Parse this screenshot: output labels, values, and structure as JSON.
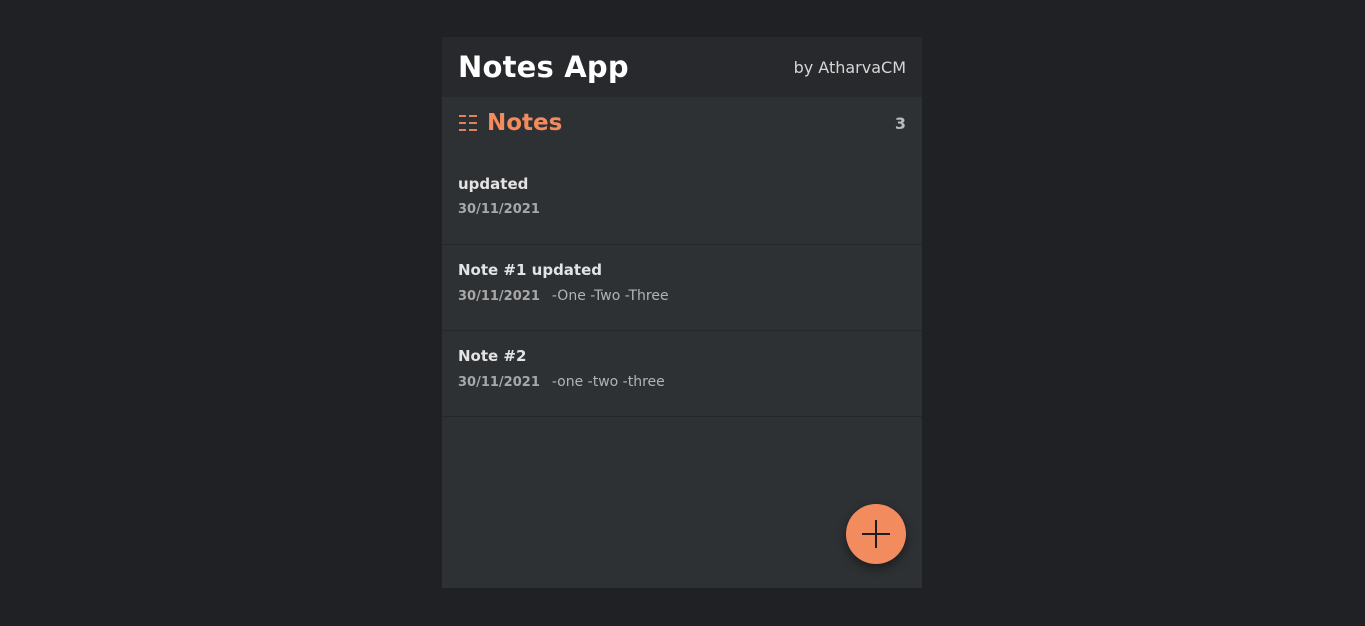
{
  "header": {
    "title": "Notes App",
    "author": "by AtharvaCM"
  },
  "notes_section": {
    "icon": "list-icon",
    "heading": "Notes",
    "count": "3"
  },
  "notes": [
    {
      "title": "updated",
      "date": "30/11/2021",
      "preview": ""
    },
    {
      "title": "Note #1 updated",
      "date": "30/11/2021",
      "preview": "-One -Two -Three"
    },
    {
      "title": "Note #2",
      "date": "30/11/2021",
      "preview": "-one -two -three"
    }
  ],
  "fab": {
    "icon": "plus-icon"
  },
  "colors": {
    "background": "#202124",
    "panel": "#2e3134",
    "header": "#28292c",
    "accent": "#f28b5e"
  }
}
